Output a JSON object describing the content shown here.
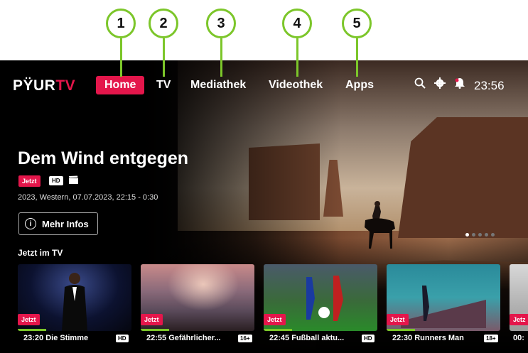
{
  "callouts": [
    "1",
    "2",
    "3",
    "4",
    "5"
  ],
  "brand": {
    "logo_pre": "PŸUR",
    "logo_accent": "TV",
    "accent_color": "#e4164b",
    "highlight_color": "#7cc62a"
  },
  "nav": {
    "home": "Home",
    "tv": "TV",
    "mediathek": "Mediathek",
    "videothek": "Videothek",
    "apps": "Apps"
  },
  "topbar": {
    "icons": [
      "search-icon",
      "gear-icon",
      "bell-icon"
    ],
    "clock": "23:56"
  },
  "hero": {
    "title": "Dem Wind entgegen",
    "badge_live": "Jetzt",
    "badge_quality": "HD",
    "meta": "2023,  Western, 07.07.2023, 22:15 - 0:30",
    "more_button": "Mehr Infos",
    "slide_count": 5,
    "active_slide": 1
  },
  "row": {
    "title": "Jetzt im TV",
    "items": [
      {
        "caption": "23:20 Die Stimme",
        "badge": "Jetzt",
        "tag": "HD",
        "progress": 0.25
      },
      {
        "caption": "22:55 Gefährlicher...",
        "badge": "Jetzt",
        "tag": "16+",
        "progress": 0.25
      },
      {
        "caption": "22:45 Fußball aktu...",
        "badge": "Jetzt",
        "tag": "HD",
        "progress": 0.25
      },
      {
        "caption": "22:30 Runners Man",
        "badge": "Jetzt",
        "tag": "18+",
        "progress": 0.25
      },
      {
        "caption": "00:",
        "badge": "Jetz",
        "tag": "",
        "progress": 0
      }
    ]
  }
}
